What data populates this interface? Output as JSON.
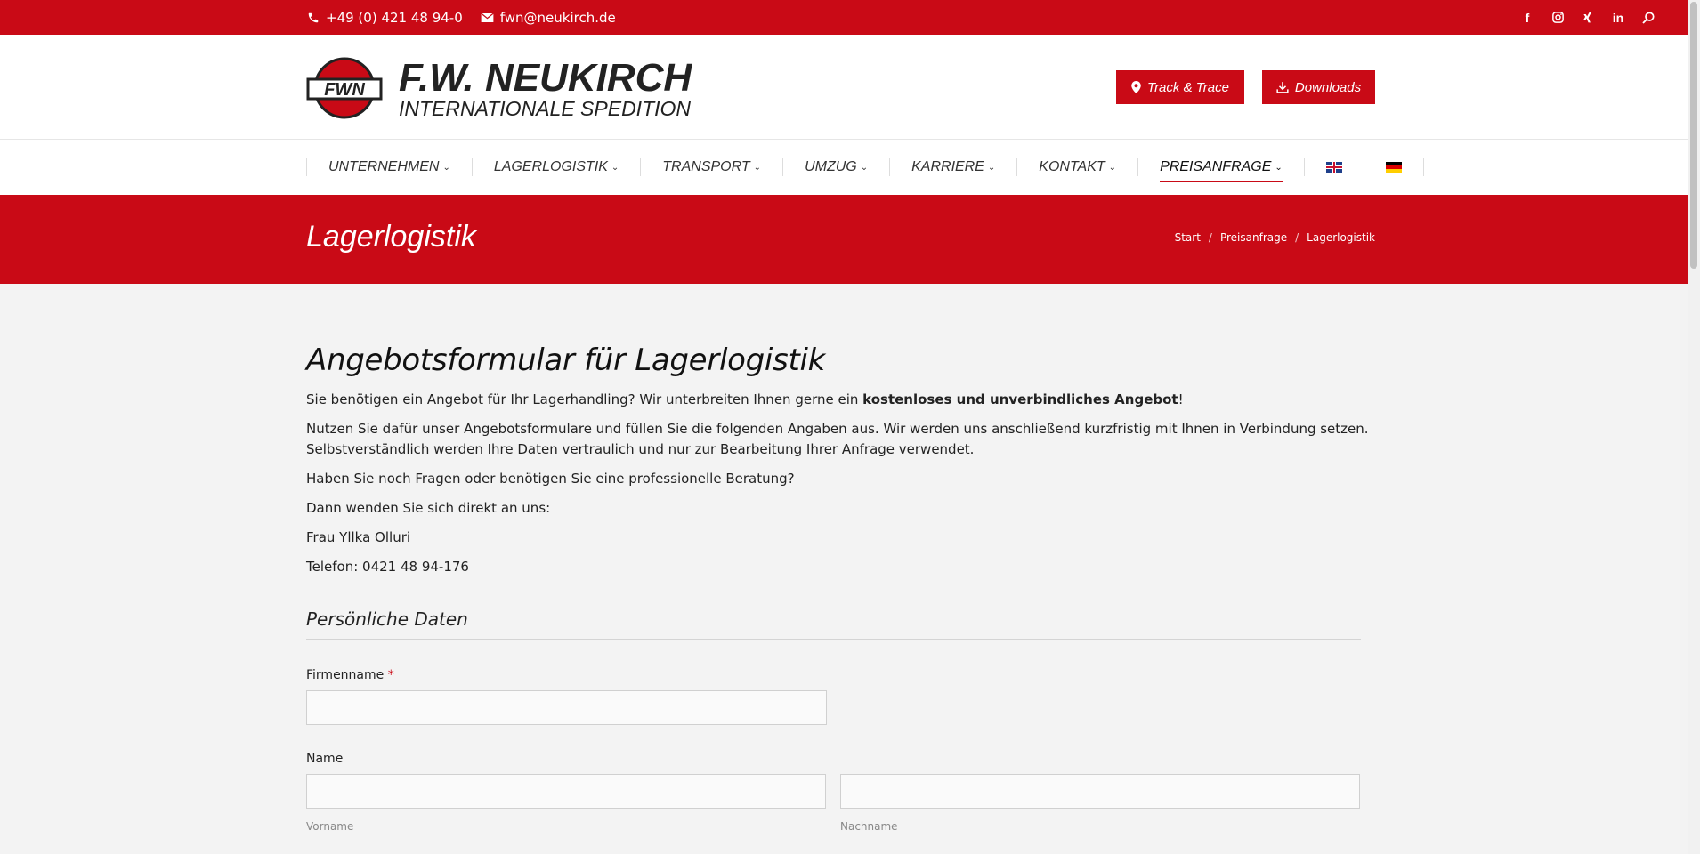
{
  "colors": {
    "brand_red": "#c90a16"
  },
  "topbar": {
    "phone": "+49 (0) 421 48 94-0",
    "email": "fwn@neukirch.de",
    "social": [
      "facebook-icon",
      "instagram-icon",
      "xing-icon",
      "linkedin-icon",
      "search-icon"
    ]
  },
  "header": {
    "logo_badge": "FWN",
    "logo_wordmark": "F.W. NEUKIRCH",
    "logo_subline": "INTERNATIONALE SPEDITION",
    "track_label": "Track & Trace",
    "downloads_label": "Downloads"
  },
  "nav": {
    "items": [
      {
        "label": "UNTERNEHMEN"
      },
      {
        "label": "LAGERLOGISTIK"
      },
      {
        "label": "TRANSPORT"
      },
      {
        "label": "UMZUG"
      },
      {
        "label": "KARRIERE"
      },
      {
        "label": "KONTAKT"
      },
      {
        "label": "PREISANFRAGE"
      }
    ]
  },
  "titlebar": {
    "title": "Lagerlogistik",
    "breadcrumbs": [
      "Start",
      "Preisanfrage",
      "Lagerlogistik"
    ]
  },
  "content": {
    "heading": "Angebotsformular für Lagerlogistik",
    "p1_before": "Sie benötigen ein Angebot für Ihr Lagerhandling? Wir unterbreiten Ihnen gerne ein ",
    "p1_bold": "kostenloses und unverbindliches Angebot",
    "p1_after": "!",
    "p2_line1": "Nutzen Sie dafür unser Angebotsformulare und füllen Sie die folgenden Angaben aus. Wir werden uns anschließend kurzfristig mit Ihnen in Verbindung setzen.",
    "p2_line2": "Selbstverständlich werden Ihre Daten vertraulich und nur zur Bearbeitung Ihrer Anfrage verwendet.",
    "p3": "Haben Sie noch Fragen oder benötigen Sie eine professionelle Beratung?",
    "p4": "Dann wenden Sie sich direkt an uns:",
    "p5": "Frau Yllka Olluri",
    "p6": "Telefon: 0421 48 94-176",
    "section_title": "Persönliche Daten",
    "firmenname_label": "Firmenname",
    "required_mark": "*",
    "name_label": "Name",
    "vorname_sub": "Vorname",
    "nachname_sub": "Nachname"
  }
}
